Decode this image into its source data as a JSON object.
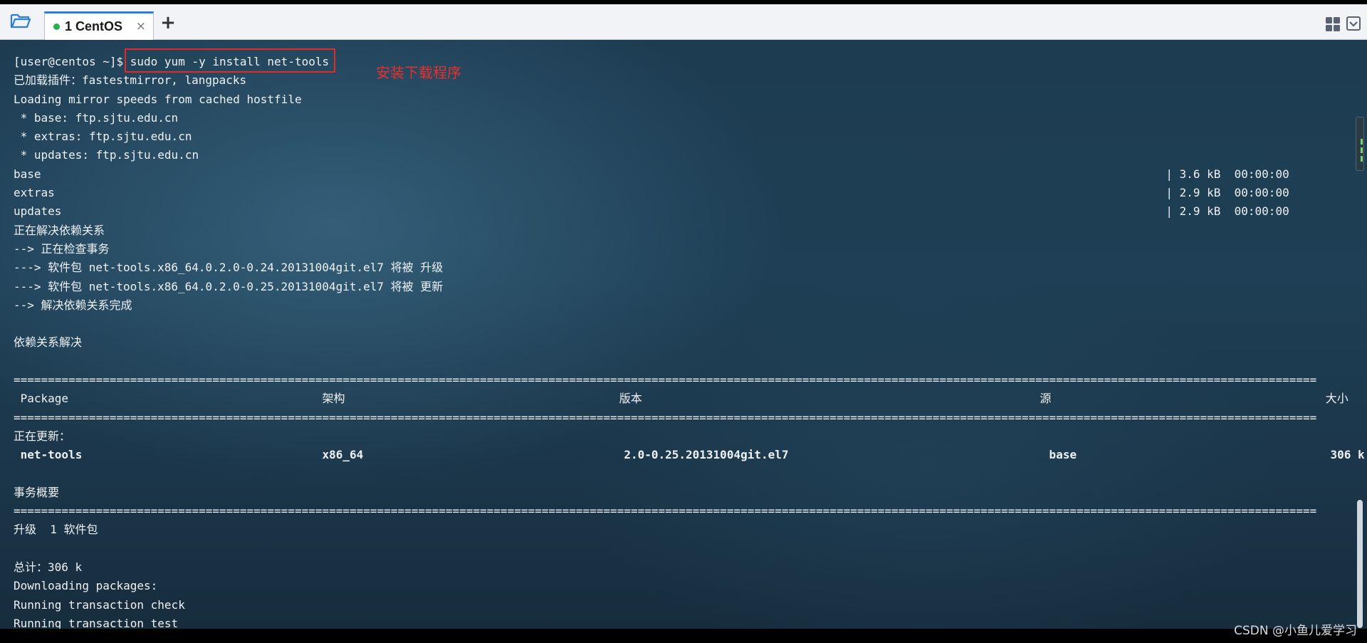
{
  "window": {
    "tab_label": "1 CentOS",
    "tab_close": "×",
    "add_tab": "+"
  },
  "terminal": {
    "lines": [
      "[user@centos ~]$ sudo yum -y install net-tools",
      "已加载插件：fastestmirror, langpacks",
      "Loading mirror speeds from cached hostfile",
      " * base: ftp.sjtu.edu.cn",
      " * extras: ftp.sjtu.edu.cn",
      " * updates: ftp.sjtu.edu.cn",
      "base                                                                                                                                                                    | 3.6 kB  00:00:00",
      "extras                                                                                                                                                                  | 2.9 kB  00:00:00",
      "updates                                                                                                                                                                 | 2.9 kB  00:00:00",
      "正在解决依赖关系",
      "--> 正在检查事务",
      "---> 软件包 net-tools.x86_64.0.2.0-0.24.20131004git.el7 将被 升级",
      "---> 软件包 net-tools.x86_64.0.2.0-0.25.20131004git.el7 将被 更新",
      "--> 解决依赖关系完成",
      "",
      "依赖关系解决",
      "",
      "==============================================================================================================================================================================================",
      " Package                                     架构                                        版本                                                          源                                        大小",
      "==============================================================================================================================================================================================",
      "正在更新：",
      " net-tools                                   x86_64                                      2.0-0.25.20131004git.el7                                      base                                     306 k",
      "",
      "事务概要",
      "==============================================================================================================================================================================================",
      "升级  1 软件包",
      "",
      "总计：306 k",
      "Downloading packages:",
      "Running transaction check",
      "Running transaction test"
    ],
    "annotation": "安装下载程序"
  },
  "watermark": "CSDN @小鱼儿爱学习",
  "colors": {
    "tab_accent": "#2b7fd8",
    "status_dot": "#22b14c",
    "highlight": "#e02b2b",
    "annotation": "#e5322d"
  },
  "icons": {
    "folder": "folder-open-icon",
    "layout": "grid-layout-icon",
    "dropdown": "chevron-down-icon"
  }
}
